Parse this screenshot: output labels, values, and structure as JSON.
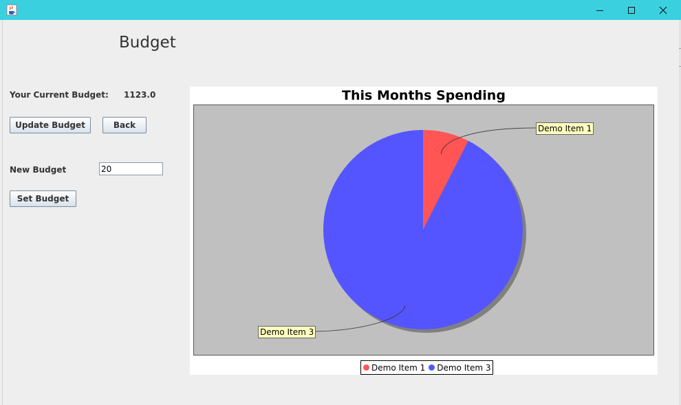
{
  "window": {
    "app_icon": "java-cup-icon",
    "controls": [
      "minimize-icon",
      "maximize-icon",
      "close-icon"
    ],
    "titlebar_color": "#3ad0e0"
  },
  "page": {
    "heading": "Budget"
  },
  "budget": {
    "current_label": "Your Current Budget:",
    "current_value": "1123.0",
    "update_button": "Update Budget",
    "back_button": "Back",
    "new_label": "New Budget",
    "new_value": "20",
    "set_button": "Set Budget"
  },
  "chart_data": {
    "type": "pie",
    "title": "This Months Spending",
    "slices": [
      {
        "label": "Demo Item 1",
        "fraction": 0.075,
        "color": "#ff5555"
      },
      {
        "label": "Demo Item 3",
        "fraction": 0.925,
        "color": "#5555ff"
      }
    ],
    "legend": [
      "Demo Item 1",
      "Demo Item 3"
    ],
    "legend_position": "bottom",
    "plot_background": "#c0c0c0"
  }
}
